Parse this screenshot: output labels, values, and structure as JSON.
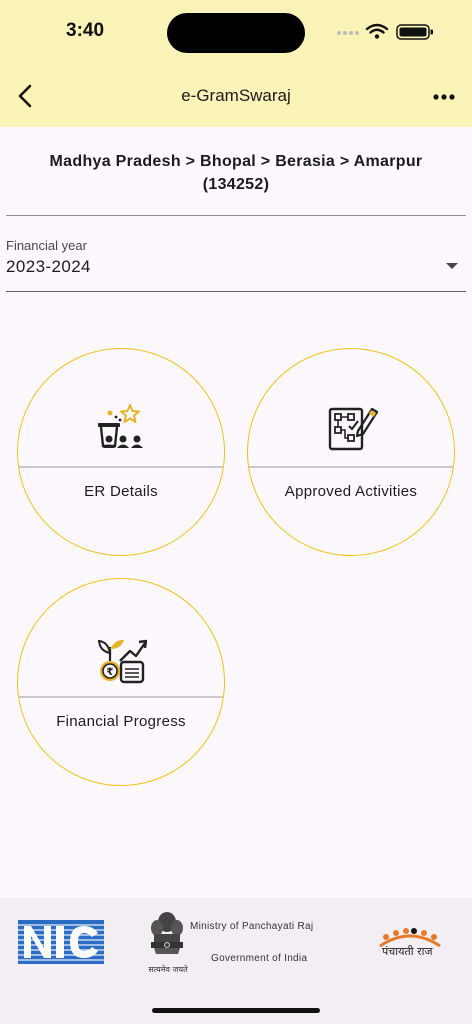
{
  "status": {
    "time": "3:40"
  },
  "header": {
    "title": "e-GramSwaraj"
  },
  "location": {
    "breadcrumb": "Madhya Pradesh > Bhopal > Berasia > Amarpur",
    "code": "(134252)"
  },
  "financial_year": {
    "label": "Financial year",
    "value": "2023-2024"
  },
  "tiles": [
    {
      "label": "ER Details",
      "icon": "elected-representatives-icon"
    },
    {
      "label": "Approved Activities",
      "icon": "activity-plan-icon"
    },
    {
      "label": "Financial Progress",
      "icon": "financial-growth-icon"
    }
  ],
  "footer": {
    "ministry": "Ministry of Panchayati Raj",
    "government": "Government of India",
    "emblem_motto": "सत्यमेव जयते",
    "panchayati_raj": "पंचायती राज"
  },
  "colors": {
    "header_bg": "#faf3b7",
    "tile_border": "#f2c21c",
    "accent_gold": "#e8b32a"
  }
}
